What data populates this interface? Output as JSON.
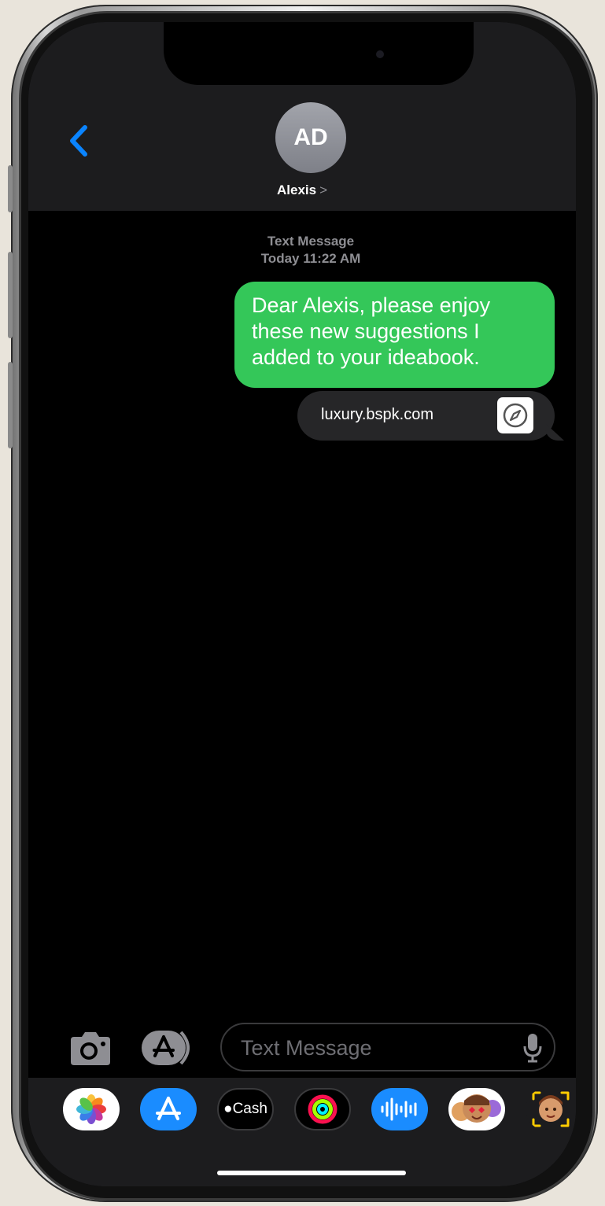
{
  "contact": {
    "initials": "AD",
    "name": "Alexis",
    "chevron": ">"
  },
  "thread": {
    "service_label": "Text Message",
    "timestamp": "Today 11:22 AM",
    "messages": [
      {
        "type": "sent",
        "text": "Dear Alexis, please enjoy these new suggestions I added to your ideabook."
      },
      {
        "type": "link",
        "text": "luxury.bspk.com",
        "icon": "compass-icon"
      }
    ]
  },
  "composer": {
    "placeholder": "Text Message"
  },
  "app_drawer": {
    "apps": [
      {
        "name": "photos-app-icon"
      },
      {
        "name": "app-store-icon"
      },
      {
        "name": "apple-cash-icon",
        "label": "Cash"
      },
      {
        "name": "activity-icon"
      },
      {
        "name": "audio-message-icon"
      },
      {
        "name": "memoji-stickers-icon"
      },
      {
        "name": "memoji-icon"
      }
    ]
  },
  "colors": {
    "sent_bubble": "#34c759",
    "accent": "#0a84ff",
    "header_bg": "#1c1c1e"
  }
}
